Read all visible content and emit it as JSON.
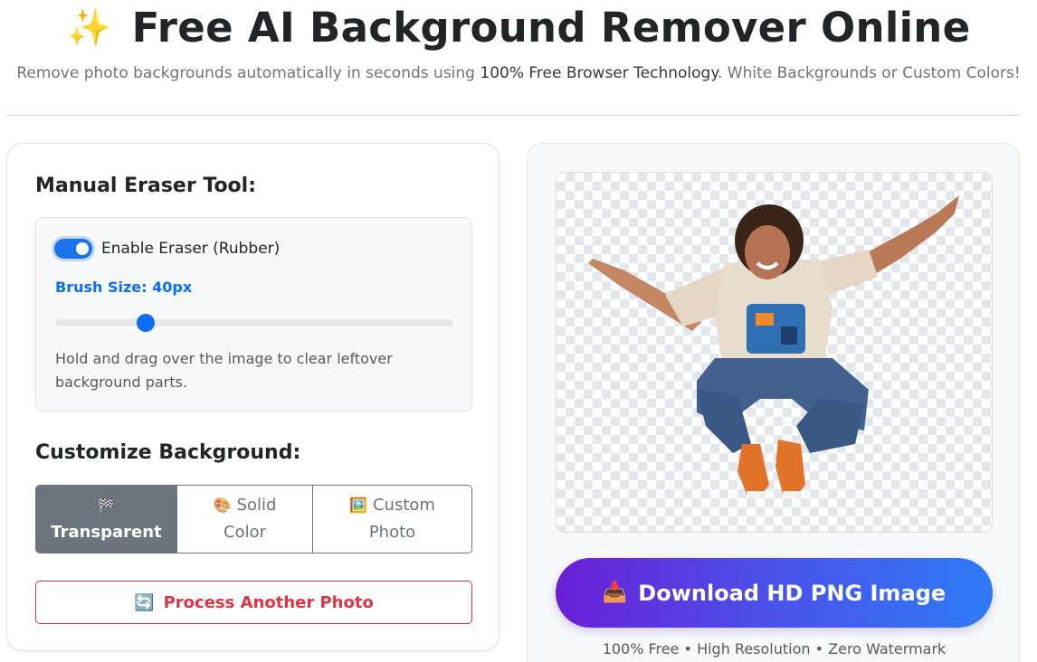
{
  "header": {
    "icon": "sparkles-icon",
    "icon_glyph": "✨",
    "title": "Free AI Background Remover Online",
    "subtitle_before": "Remove photo backgrounds automatically in seconds using ",
    "subtitle_strong": "100% Free Browser Technology",
    "subtitle_after": ". White Backgrounds or Custom Colors!"
  },
  "eraser": {
    "section_title": "Manual Eraser Tool:",
    "toggle_label": "Enable Eraser (Rubber)",
    "toggle_on": true,
    "brush_label": "Brush Size: 40px",
    "brush_size": 40,
    "brush_fraction": 0.227,
    "help_text": "Hold and drag over the image to clear leftover background parts."
  },
  "background": {
    "section_title": "Customize Background:",
    "options": [
      {
        "icon": "checkered-flag-icon",
        "glyph": "🏁",
        "label": "Transparent",
        "active": true
      },
      {
        "icon": "palette-icon",
        "glyph": "🎨",
        "label_1": "Solid",
        "label_2": "Color",
        "active": false
      },
      {
        "icon": "picture-icon",
        "glyph": "🖼️",
        "label_1": "Custom",
        "label_2": "Photo",
        "active": false
      }
    ]
  },
  "process_button": {
    "icon": "refresh-icon",
    "glyph": "🔄",
    "label": "Process Another Photo"
  },
  "download_button": {
    "icon": "download-icon",
    "glyph": "📥",
    "label": "Download HD PNG Image"
  },
  "footer_note": "100% Free • High Resolution • Zero Watermark",
  "colors": {
    "accent": "#0d6efd",
    "danger": "#dc3545",
    "gradient_start": "#6a1fd6",
    "gradient_end": "#2f7bf7"
  }
}
